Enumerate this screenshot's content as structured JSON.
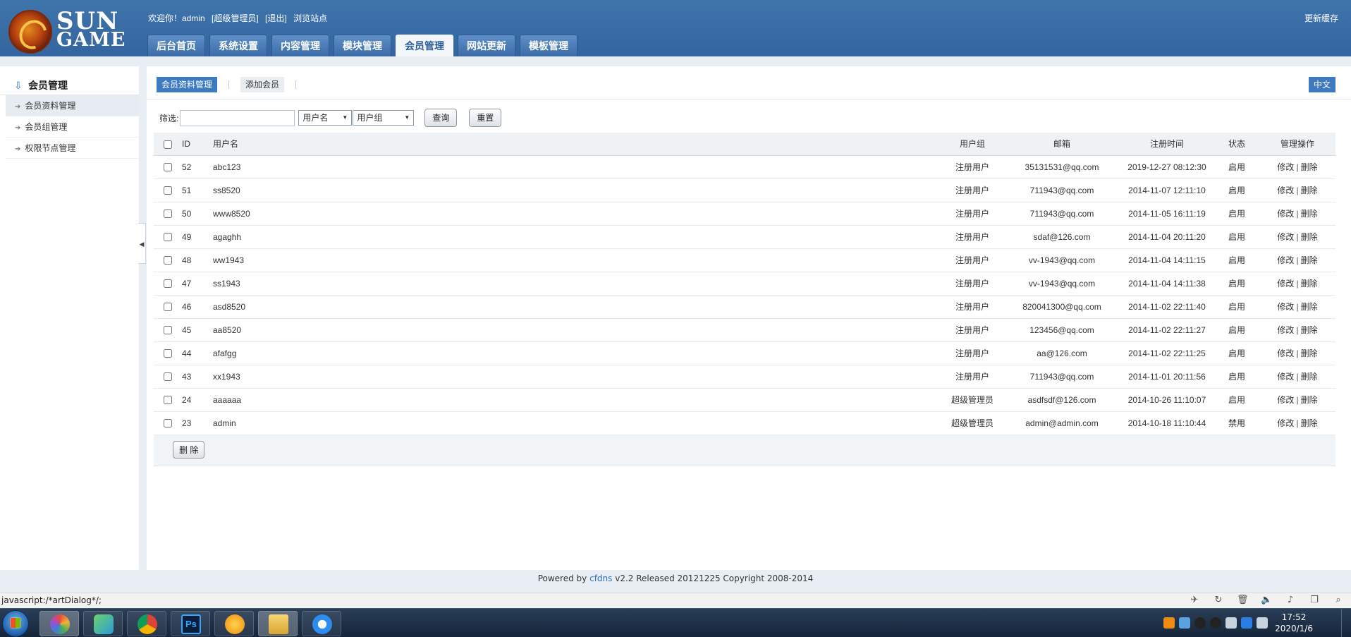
{
  "header": {
    "logo_top": "SUN",
    "logo_bottom": "GAME",
    "welcome": "欢迎你！admin",
    "role": "[超级管理员]",
    "logout": "[退出]",
    "browse_site": "浏览站点",
    "update_cache": "更新缓存",
    "tabs": [
      {
        "label": "后台首页"
      },
      {
        "label": "系统设置"
      },
      {
        "label": "内容管理"
      },
      {
        "label": "模块管理"
      },
      {
        "label": "会员管理",
        "active": true
      },
      {
        "label": "网站更新"
      },
      {
        "label": "模板管理"
      }
    ]
  },
  "sidebar": {
    "title": "会员管理",
    "items": [
      {
        "label": "会员资料管理",
        "active": true
      },
      {
        "label": "会员组管理"
      },
      {
        "label": "权限节点管理"
      }
    ]
  },
  "main": {
    "subtabs": [
      {
        "label": "会员资料管理",
        "active": true
      },
      {
        "label": "添加会员"
      }
    ],
    "language": "中文",
    "filter": {
      "label": "筛选:",
      "input_value": "",
      "field_select": "用户名",
      "group_select": "用户组",
      "search_button": "查询",
      "reset_button": "重置"
    },
    "table": {
      "headers": {
        "id": "ID",
        "username": "用户名",
        "group": "用户组",
        "email": "邮箱",
        "reg_time": "注册时间",
        "status": "状态",
        "actions": "管理操作"
      },
      "edit_label": "修改",
      "delete_label": "删除",
      "rows": [
        {
          "id": "52",
          "username": "abc123",
          "group": "注册用户",
          "email": "35131531@qq.com",
          "reg_time": "2019-12-27 08:12:30",
          "status": "启用"
        },
        {
          "id": "51",
          "username": "ss8520",
          "group": "注册用户",
          "email": "711943@qq.com",
          "reg_time": "2014-11-07 12:11:10",
          "status": "启用"
        },
        {
          "id": "50",
          "username": "www8520",
          "group": "注册用户",
          "email": "711943@qq.com",
          "reg_time": "2014-11-05 16:11:19",
          "status": "启用"
        },
        {
          "id": "49",
          "username": "agaghh",
          "group": "注册用户",
          "email": "sdaf@126.com",
          "reg_time": "2014-11-04 20:11:20",
          "status": "启用"
        },
        {
          "id": "48",
          "username": "ww1943",
          "group": "注册用户",
          "email": "vv-1943@qq.com",
          "reg_time": "2014-11-04 14:11:15",
          "status": "启用"
        },
        {
          "id": "47",
          "username": "ss1943",
          "group": "注册用户",
          "email": "vv-1943@qq.com",
          "reg_time": "2014-11-04 14:11:38",
          "status": "启用"
        },
        {
          "id": "46",
          "username": "asd8520",
          "group": "注册用户",
          "email": "820041300@qq.com",
          "reg_time": "2014-11-02 22:11:40",
          "status": "启用"
        },
        {
          "id": "45",
          "username": "aa8520",
          "group": "注册用户",
          "email": "123456@qq.com",
          "reg_time": "2014-11-02 22:11:27",
          "status": "启用"
        },
        {
          "id": "44",
          "username": "afafgg",
          "group": "注册用户",
          "email": "aa@126.com",
          "reg_time": "2014-11-02 22:11:25",
          "status": "启用"
        },
        {
          "id": "43",
          "username": "xx1943",
          "group": "注册用户",
          "email": "711943@qq.com",
          "reg_time": "2014-11-01 20:11:56",
          "status": "启用"
        },
        {
          "id": "24",
          "username": "aaaaaa",
          "group": "超级管理员",
          "email": "asdfsdf@126.com",
          "reg_time": "2014-10-26 11:10:07",
          "status": "启用"
        },
        {
          "id": "23",
          "username": "admin",
          "group": "超级管理员",
          "email": "admin@admin.com",
          "reg_time": "2014-10-18 11:10:44",
          "status": "禁用"
        }
      ],
      "delete_button": "删 除"
    }
  },
  "footer": {
    "prefix": "Powered by",
    "brand": "cfdns",
    "suffix": "v2.2 Released 20121225 Copyright 2008-2014"
  },
  "browser": {
    "status_text": "javascript:/*artDialog*/;"
  },
  "taskbar": {
    "time": "17:52",
    "date": "2020/1/6"
  }
}
